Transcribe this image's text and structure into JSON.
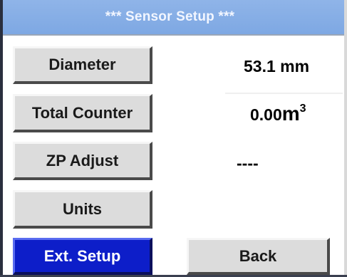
{
  "header": {
    "title": "*** Sensor Setup ***"
  },
  "rows": [
    {
      "button_label": "Diameter",
      "value": "53.1 mm"
    },
    {
      "button_label": "Total Counter",
      "value_number": "0.00",
      "value_unit": "m",
      "value_exponent": "3"
    },
    {
      "button_label": "ZP Adjust",
      "value": "----"
    },
    {
      "button_label": "Units"
    }
  ],
  "footer": {
    "ext_setup_label": "Ext. Setup",
    "back_label": "Back"
  },
  "colors": {
    "title_bar": "#7ea8e3",
    "button_face": "#dcdcdc",
    "active_button": "#0d1ec9"
  }
}
